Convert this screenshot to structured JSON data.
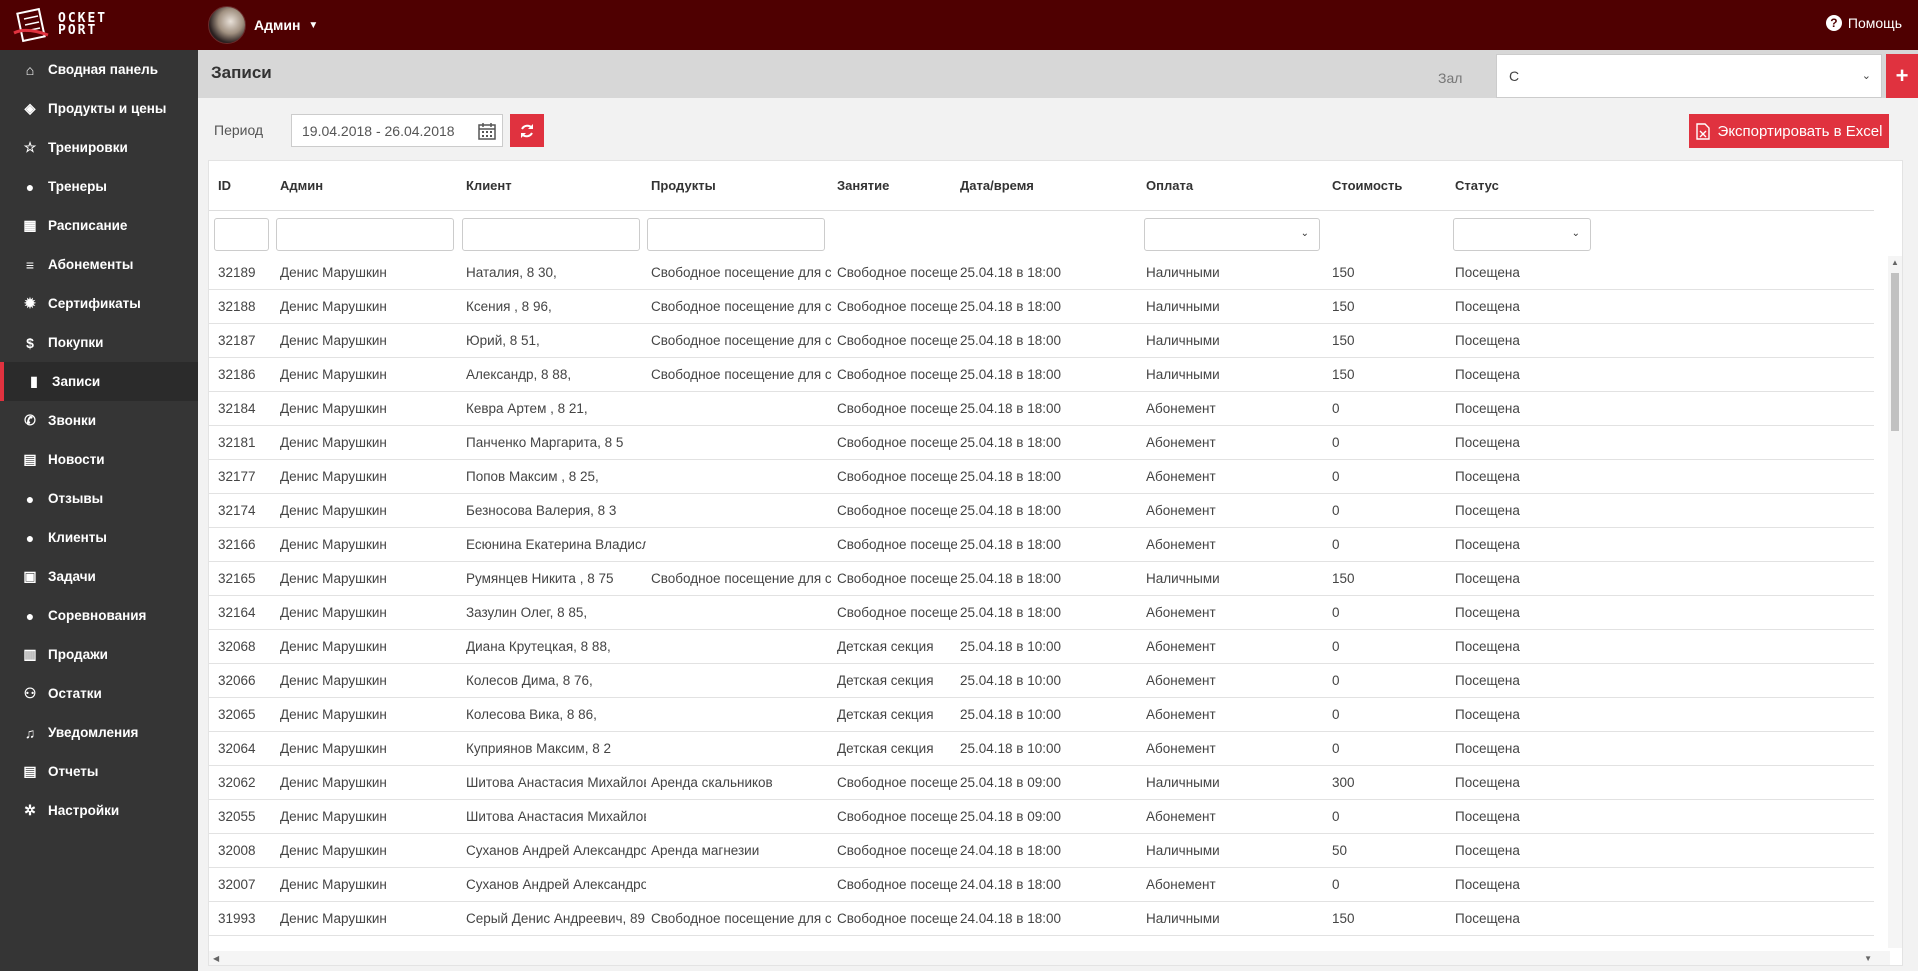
{
  "app": {
    "logo_text_top": "OCKET",
    "logo_text_bottom": "PORT",
    "user_name": "Админ",
    "help_label": "Помощь"
  },
  "sidebar": {
    "items": [
      {
        "label": "Сводная панель",
        "icon": "home-icon"
      },
      {
        "label": "Продукты и цены",
        "icon": "cube-icon"
      },
      {
        "label": "Тренировки",
        "icon": "star-icon"
      },
      {
        "label": "Тренеры",
        "icon": "android-icon"
      },
      {
        "label": "Расписание",
        "icon": "calendar-icon"
      },
      {
        "label": "Абонементы",
        "icon": "database-icon"
      },
      {
        "label": "Сертификаты",
        "icon": "certificate-icon"
      },
      {
        "label": "Покупки",
        "icon": "dollar-icon"
      },
      {
        "label": "Записи",
        "icon": "book-icon"
      },
      {
        "label": "Звонки",
        "icon": "phone-icon"
      },
      {
        "label": "Новости",
        "icon": "newspaper-icon"
      },
      {
        "label": "Отзывы",
        "icon": "comment-icon"
      },
      {
        "label": "Клиенты",
        "icon": "user-icon"
      },
      {
        "label": "Задачи",
        "icon": "briefcase-icon"
      },
      {
        "label": "Соревнования",
        "icon": "trophy-icon"
      },
      {
        "label": "Продажи",
        "icon": "bar-chart-icon"
      },
      {
        "label": "Остатки",
        "icon": "archive-icon"
      },
      {
        "label": "Уведомления",
        "icon": "bell-icon"
      },
      {
        "label": "Отчеты",
        "icon": "list-alt-icon"
      },
      {
        "label": "Настройки",
        "icon": "cog-icon"
      }
    ],
    "active": "Записи"
  },
  "header": {
    "title": "Записи",
    "hall_label": "Зал",
    "hall_value": "С",
    "add_label": "+"
  },
  "toolbar": {
    "period_label": "Период",
    "period_value": "19.04.2018 - 26.04.2018",
    "export_label": "Экспортировать в Excel"
  },
  "table": {
    "columns": [
      "ID",
      "Админ",
      "Клиент",
      "Продукты",
      "Занятие",
      "Дата/время",
      "Оплата",
      "Стоимость",
      "Статус"
    ],
    "rows": [
      [
        "32189",
        "Денис Марушкин",
        "Наталия, 8 30,",
        "Свободное посещение для студе",
        "Свободное посещени",
        "25.04.18 в 18:00",
        "Наличными",
        "150",
        "Посещена"
      ],
      [
        "32188",
        "Денис Марушкин",
        "Ксения , 8 96,",
        "Свободное посещение для студе",
        "Свободное посещени",
        "25.04.18 в 18:00",
        "Наличными",
        "150",
        "Посещена"
      ],
      [
        "32187",
        "Денис Марушкин",
        "Юрий, 8 51,",
        "Свободное посещение для студе",
        "Свободное посещени",
        "25.04.18 в 18:00",
        "Наличными",
        "150",
        "Посещена"
      ],
      [
        "32186",
        "Денис Марушкин",
        "Александр, 8 88,",
        "Свободное посещение для студе",
        "Свободное посещени",
        "25.04.18 в 18:00",
        "Наличными",
        "150",
        "Посещена"
      ],
      [
        "32184",
        "Денис Марушкин",
        "Кевра Артем , 8 21,",
        "",
        "Свободное посещени",
        "25.04.18 в 18:00",
        "Абонемент",
        "0",
        "Посещена"
      ],
      [
        "32181",
        "Денис Марушкин",
        "Панченко Маргарита, 8 5",
        "",
        "Свободное посещени",
        "25.04.18 в 18:00",
        "Абонемент",
        "0",
        "Посещена"
      ],
      [
        "32177",
        "Денис Марушкин",
        "Попов Максим , 8 25,",
        "",
        "Свободное посещени",
        "25.04.18 в 18:00",
        "Абонемент",
        "0",
        "Посещена"
      ],
      [
        "32174",
        "Денис Марушкин",
        "Безносова Валерия, 8 3",
        "",
        "Свободное посещени",
        "25.04.18 в 18:00",
        "Абонемент",
        "0",
        "Посещена"
      ],
      [
        "32166",
        "Денис Марушкин",
        "Есюнина Екатерина Владиславов",
        "",
        "Свободное посещени",
        "25.04.18 в 18:00",
        "Абонемент",
        "0",
        "Посещена"
      ],
      [
        "32165",
        "Денис Марушкин",
        "Румянцев Никита , 8 75",
        "Свободное посещение для студе",
        "Свободное посещени",
        "25.04.18 в 18:00",
        "Наличными",
        "150",
        "Посещена"
      ],
      [
        "32164",
        "Денис Марушкин",
        "Зазулин Олег, 8 85,",
        "",
        "Свободное посещени",
        "25.04.18 в 18:00",
        "Абонемент",
        "0",
        "Посещена"
      ],
      [
        "32068",
        "Денис Марушкин",
        "Диана Крутецкая, 8 88,",
        "",
        "Детская секция",
        "25.04.18 в 10:00",
        "Абонемент",
        "0",
        "Посещена"
      ],
      [
        "32066",
        "Денис Марушкин",
        "Колесов Дима, 8 76,",
        "",
        "Детская секция",
        "25.04.18 в 10:00",
        "Абонемент",
        "0",
        "Посещена"
      ],
      [
        "32065",
        "Денис Марушкин",
        "Колесова Вика, 8 86,",
        "",
        "Детская секция",
        "25.04.18 в 10:00",
        "Абонемент",
        "0",
        "Посещена"
      ],
      [
        "32064",
        "Денис Марушкин",
        "Куприянов Максим, 8 2",
        "",
        "Детская секция",
        "25.04.18 в 10:00",
        "Абонемент",
        "0",
        "Посещена"
      ],
      [
        "32062",
        "Денис Марушкин",
        "Шитова Анастасия Михайловна,",
        "Аренда скальников",
        "Свободное посещени",
        "25.04.18 в 09:00",
        "Наличными",
        "300",
        "Посещена"
      ],
      [
        "32055",
        "Денис Марушкин",
        "Шитова Анастасия Михайловна,",
        "",
        "Свободное посещени",
        "25.04.18 в 09:00",
        "Абонемент",
        "0",
        "Посещена"
      ],
      [
        "32008",
        "Денис Марушкин",
        "Суханов Андрей Александрович,",
        "Аренда магнезии",
        "Свободное посещени",
        "24.04.18 в 18:00",
        "Наличными",
        "50",
        "Посещена"
      ],
      [
        "32007",
        "Денис Марушкин",
        "Суханов Андрей Александрович,",
        "",
        "Свободное посещени",
        "24.04.18 в 18:00",
        "Абонемент",
        "0",
        "Посещена"
      ],
      [
        "31993",
        "Денис Марушкин",
        "Серый Денис Андреевич, 89",
        "Свободное посещение для студе",
        "Свободное посещени",
        "24.04.18 в 18:00",
        "Наличными",
        "150",
        "Посещена"
      ]
    ]
  },
  "colors": {
    "topbar": "#4f0001",
    "sidebar": "#353535",
    "accent": "#e0323f"
  }
}
